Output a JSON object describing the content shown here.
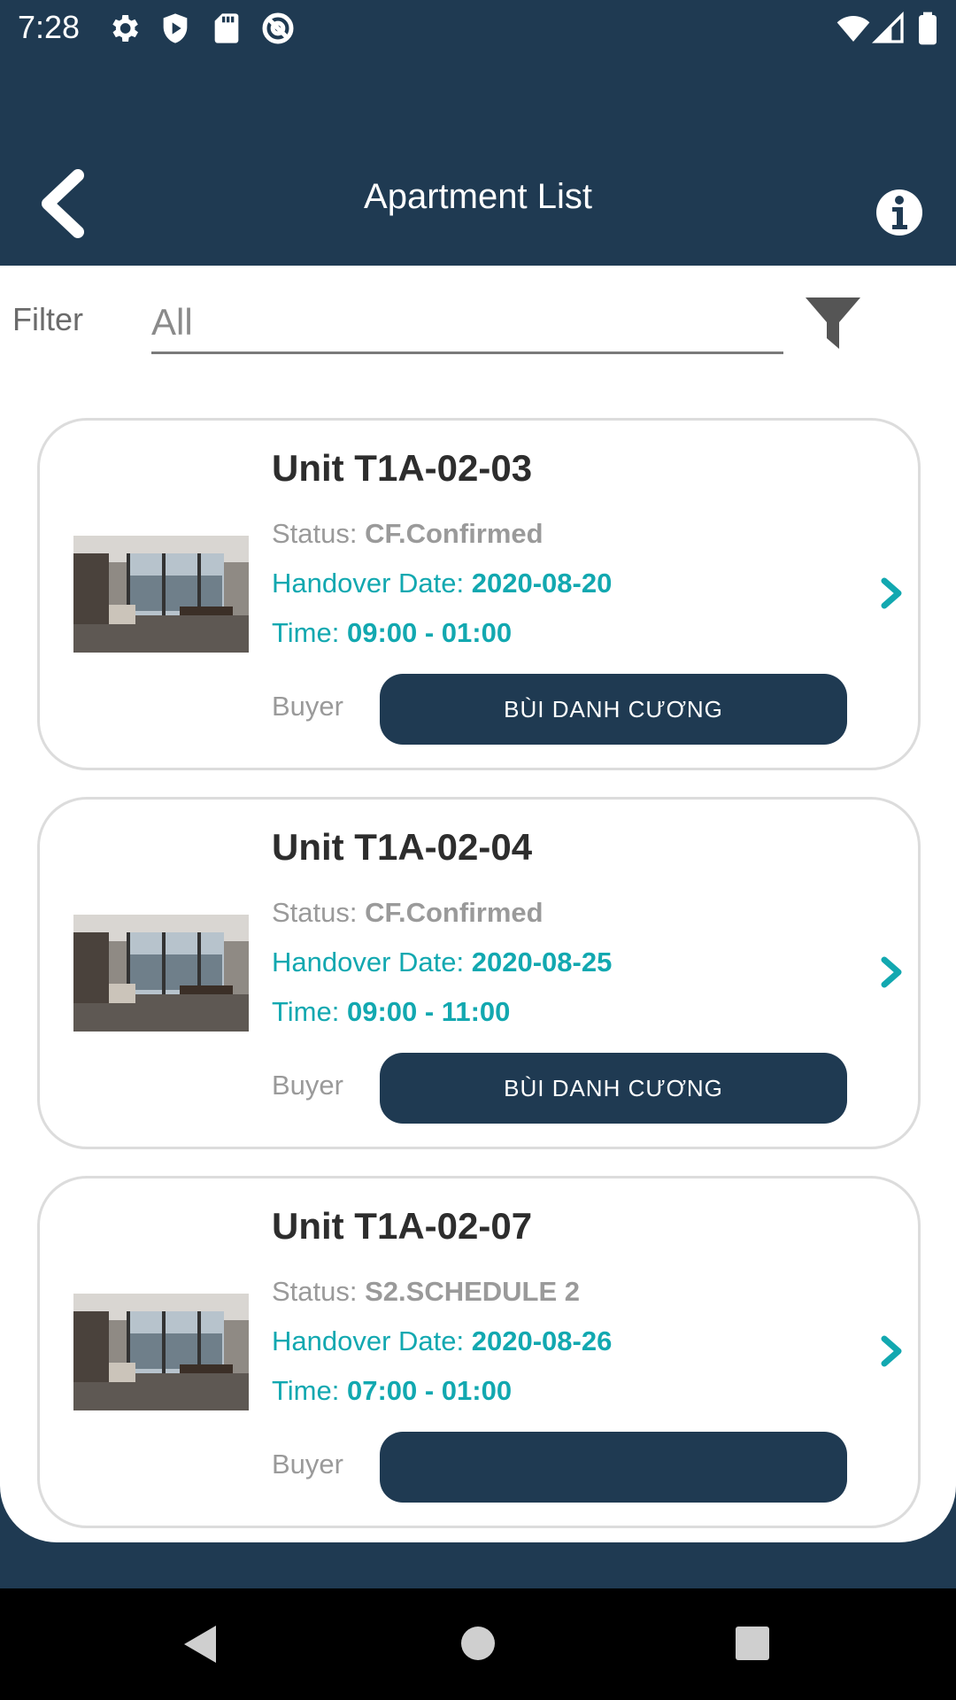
{
  "status_bar": {
    "time": "7:28",
    "left_icons": [
      "gear-icon",
      "shield-icon",
      "sd-card-icon",
      "at-sign-icon"
    ],
    "right_icons": [
      "wifi-icon",
      "signal-icon",
      "battery-icon"
    ]
  },
  "app_bar": {
    "title": "Apartment List",
    "back_icon": "chevron-left-icon",
    "info_icon": "info-icon"
  },
  "filter": {
    "label": "Filter",
    "value": "All",
    "icon": "funnel-icon"
  },
  "apartments": [
    {
      "unit": "Unit T1A-02-03",
      "status_label": "Status: ",
      "status_value": "CF.Confirmed",
      "handover_label": "Handover Date: ",
      "handover_value": "2020-08-20",
      "time_label": "Time: ",
      "time_value": "09:00 - 01:00",
      "buyer_label": "Buyer",
      "buyer_name": "BÙI DANH CƯƠNG"
    },
    {
      "unit": "Unit T1A-02-04",
      "status_label": "Status: ",
      "status_value": "CF.Confirmed",
      "handover_label": "Handover Date: ",
      "handover_value": "2020-08-25",
      "time_label": "Time: ",
      "time_value": "09:00 - 11:00",
      "buyer_label": "Buyer",
      "buyer_name": "BÙI DANH CƯƠNG"
    },
    {
      "unit": "Unit T1A-02-07",
      "status_label": "Status: ",
      "status_value": "S2.SCHEDULE 2",
      "handover_label": "Handover Date: ",
      "handover_value": "2020-08-26",
      "time_label": "Time: ",
      "time_value": "07:00 - 01:00",
      "buyer_label": "Buyer",
      "buyer_name": ""
    }
  ],
  "colors": {
    "primary": "#1f3a52",
    "accent": "#12a8b0",
    "muted": "#9a9a9a"
  },
  "nav_bar": [
    "back-triangle-icon",
    "home-circle-icon",
    "recents-square-icon"
  ]
}
